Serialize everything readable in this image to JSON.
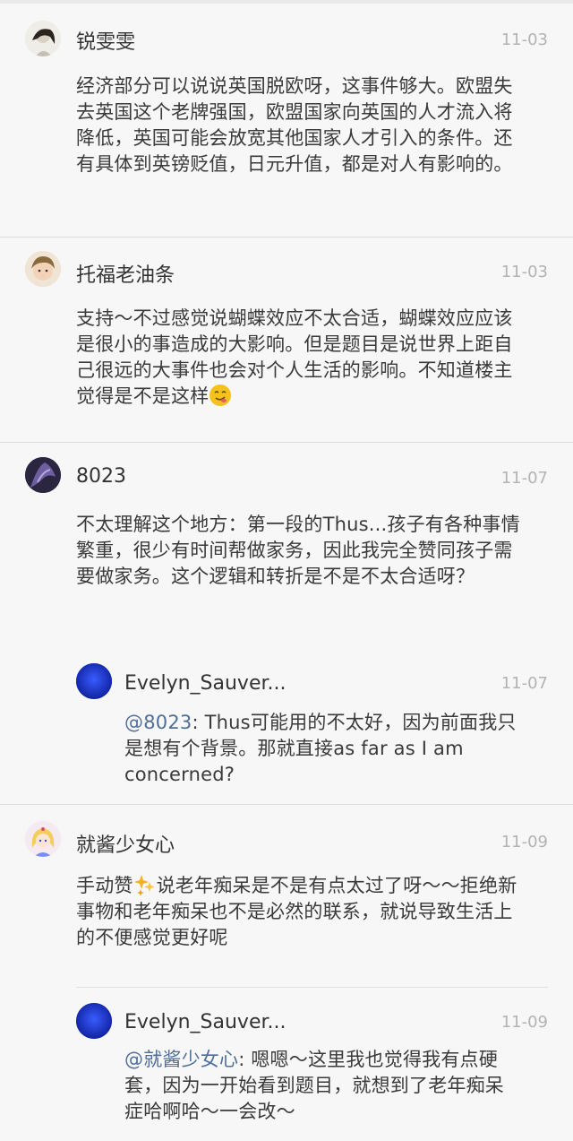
{
  "comments": [
    {
      "user": "锐雯雯",
      "date": "11-03",
      "text": "经济部分可以说说英国脱欧呀，这事件够大。欧盟失去英国这个老牌强国，欧盟国家向英国的人才流入将降低，英国可能会放宽其他国家人才引入的条件。还有具体到英镑贬值，日元升值，都是对人有影响的。"
    },
    {
      "user": "托福老油条",
      "date": "11-03",
      "text": "支持～不过感觉说蝴蝶效应不太合适，蝴蝶效应应该是很小的事造成的大影响。但是题目是说世界上距自己很远的大事件也会对个人生活的影响。不知道楼主觉得是不是这样",
      "emoji": "smiling-face-emoji"
    },
    {
      "user": "8023",
      "date": "11-07",
      "text": "不太理解这个地方：第一段的Thus...孩子有各种事情繁重，很少有时间帮做家务，因此我完全赞同孩子需要做家务。这个逻辑和转折是不是不太合适呀？",
      "reply": {
        "user": "Evelyn_Sauver...",
        "date": "11-07",
        "mention": "@8023",
        "text": ": Thus可能用的不太好，因为前面我只是想有个背景。那就直接as far as  I am concerned?"
      }
    },
    {
      "user": "就酱少女心",
      "date": "11-09",
      "text_before": "手动赞",
      "emoji": "sparkle-emoji",
      "text_after": "说老年痴呆是不是有点太过了呀～～拒绝新事物和老年痴呆也不是必然的联系，就说导致生活上的不便感觉更好呢",
      "reply": {
        "user": "Evelyn_Sauver...",
        "date": "11-09",
        "mention": "@就酱少女心",
        "text": ": 嗯嗯～这里我也觉得我有点硬套，因为一开始看到题目，就想到了老年痴呆症哈啊哈～一会改～"
      }
    }
  ],
  "colors": {
    "background": "#f7f7f7",
    "date": "#b3b3b3",
    "mention": "#4f6e9a",
    "reply_avatar": "#1b3fd6"
  }
}
